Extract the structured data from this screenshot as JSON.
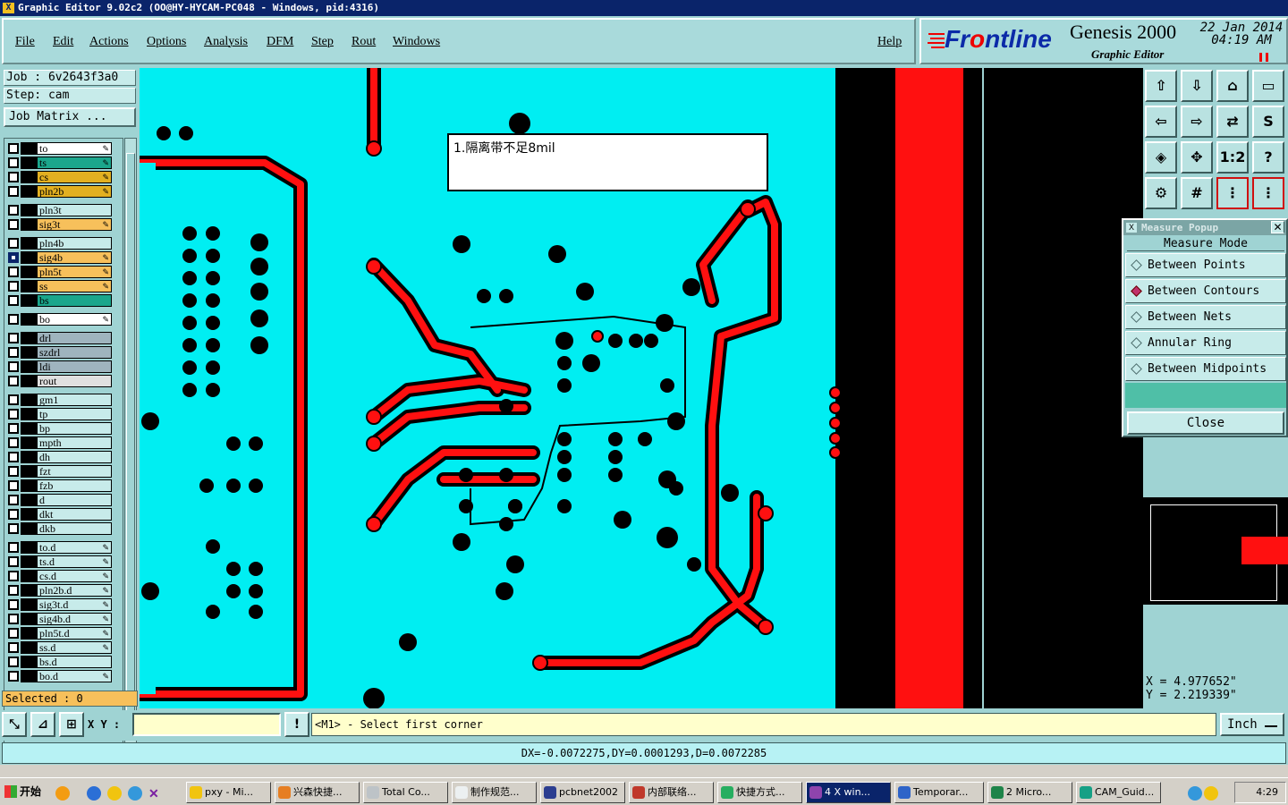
{
  "window": {
    "title": "Graphic Editor 9.02c2  (OO@HY-HYCAM-PC048 - Windows, pid:4316)"
  },
  "menu": [
    {
      "label": "File"
    },
    {
      "label": "Edit"
    },
    {
      "label": "Actions"
    },
    {
      "label": "Options"
    },
    {
      "label": "Analysis"
    },
    {
      "label": "DFM"
    },
    {
      "label": "Step"
    },
    {
      "label": "Rout"
    },
    {
      "label": "Windows"
    },
    {
      "label": "Help"
    }
  ],
  "brand": {
    "logo_prefix": "Fr",
    "logo_mid": "o",
    "logo_suffix": "ntline",
    "product": "Genesis 2000",
    "subtitle": "Graphic Editor",
    "date_line1": "22 Jan 2014",
    "date_line2": "04:19 AM"
  },
  "job": {
    "job_line": "Job : 6v2643f3a0",
    "step_line": "Step: cam",
    "matrix_button": "Job Matrix ..."
  },
  "layers": [
    {
      "name": "to",
      "color": "#ffffff",
      "side": "#000000",
      "pen": true
    },
    {
      "name": "ts",
      "color": "#1ba68c",
      "side": "#000000",
      "pen": true
    },
    {
      "name": "cs",
      "color": "#e2b021",
      "side": "#000000",
      "pen": true
    },
    {
      "name": "pln2b",
      "color": "#e2b021",
      "side": "#000000",
      "pen": true
    },
    {
      "name": "pln3t",
      "color": "#c7ebea",
      "side": "#000000",
      "pen": false
    },
    {
      "name": "sig3t",
      "color": "#f7c05b",
      "side": "#000000",
      "pen": true
    },
    {
      "name": "pln4b",
      "color": "#c7ebea",
      "side": "#000000",
      "pen": false
    },
    {
      "name": "sig4b",
      "color": "#f7c05b",
      "side": "#000000",
      "pen": true,
      "active": true
    },
    {
      "name": "pln5t",
      "color": "#f7c05b",
      "side": "#000000",
      "pen": true
    },
    {
      "name": "ss",
      "color": "#f7c05b",
      "side": "#000000",
      "pen": true
    },
    {
      "name": "bs",
      "color": "#1ba68c",
      "side": "#000000",
      "pen": false
    },
    {
      "name": "bo",
      "color": "#ffffff",
      "side": "#000000",
      "pen": true
    },
    {
      "name": "drl",
      "color": "#9fb4be",
      "side": "#000000",
      "pen": false
    },
    {
      "name": "szdrl",
      "color": "#9fb4be",
      "side": "#000000",
      "pen": false
    },
    {
      "name": "ldi",
      "color": "#9fb4be",
      "side": "#000000",
      "pen": false
    },
    {
      "name": "rout",
      "color": "#e0e0e0",
      "side": "#000000",
      "pen": false
    },
    {
      "name": "gm1",
      "color": "#c7ebea",
      "side": "#000000",
      "pen": false
    },
    {
      "name": "tp",
      "color": "#c7ebea",
      "side": "#000000",
      "pen": false
    },
    {
      "name": "bp",
      "color": "#c7ebea",
      "side": "#000000",
      "pen": false
    },
    {
      "name": "mpth",
      "color": "#c7ebea",
      "side": "#000000",
      "pen": false
    },
    {
      "name": "dh",
      "color": "#c7ebea",
      "side": "#000000",
      "pen": false
    },
    {
      "name": "fzt",
      "color": "#c7ebea",
      "side": "#000000",
      "pen": false
    },
    {
      "name": "fzb",
      "color": "#c7ebea",
      "side": "#000000",
      "pen": false
    },
    {
      "name": "d",
      "color": "#c7ebea",
      "side": "#000000",
      "pen": false
    },
    {
      "name": "dkt",
      "color": "#c7ebea",
      "side": "#000000",
      "pen": false
    },
    {
      "name": "dkb",
      "color": "#c7ebea",
      "side": "#000000",
      "pen": false
    },
    {
      "name": "to.d",
      "color": "#c7ebea",
      "side": "#000000",
      "pen": true
    },
    {
      "name": "ts.d",
      "color": "#c7ebea",
      "side": "#000000",
      "pen": true
    },
    {
      "name": "cs.d",
      "color": "#c7ebea",
      "side": "#000000",
      "pen": true
    },
    {
      "name": "pln2b.d",
      "color": "#c7ebea",
      "side": "#000000",
      "pen": true
    },
    {
      "name": "sig3t.d",
      "color": "#c7ebea",
      "side": "#000000",
      "pen": true
    },
    {
      "name": "sig4b.d",
      "color": "#c7ebea",
      "side": "#000000",
      "pen": true
    },
    {
      "name": "pln5t.d",
      "color": "#c7ebea",
      "side": "#000000",
      "pen": true
    },
    {
      "name": "ss.d",
      "color": "#c7ebea",
      "side": "#000000",
      "pen": true
    },
    {
      "name": "bs.d",
      "color": "#c7ebea",
      "side": "#000000",
      "pen": false
    },
    {
      "name": "bo.d",
      "color": "#c7ebea",
      "side": "#000000",
      "pen": true
    }
  ],
  "selected": "Selected : 0",
  "canvas": {
    "annotation": "1.隔离带不足8mil",
    "board_color": "#00eef2",
    "trace_color": "#ff1010"
  },
  "measure": {
    "title": "Measure Popup",
    "mode_label": "Measure Mode",
    "options": [
      {
        "label": "Between Points",
        "selected": false
      },
      {
        "label": "Between Contours",
        "selected": true
      },
      {
        "label": "Between Nets",
        "selected": false
      },
      {
        "label": "Annular Ring",
        "selected": false
      },
      {
        "label": "Between Midpoints",
        "selected": false
      }
    ],
    "close_label": "Close"
  },
  "coords": {
    "x": "X = 4.977652\"",
    "y": "Y = 2.219339\""
  },
  "bottom": {
    "xy_label": "X Y :",
    "xy_value": "",
    "prompt": "<M1> - Select first corner",
    "unit": "Inch"
  },
  "status": "DX=-0.0072275,DY=0.0001293,D=0.0072285",
  "taskbar": {
    "start": "开始",
    "items": [
      {
        "label": "pxy - Mi...",
        "icon": "clock-icon"
      },
      {
        "label": "兴森快捷...",
        "icon": "star-icon"
      },
      {
        "label": "Total Co...",
        "icon": "folder-icon"
      },
      {
        "label": "制作规范...",
        "icon": "document-icon"
      },
      {
        "label": "pcbnet2002",
        "icon": "shield-icon"
      },
      {
        "label": "内部联络...",
        "icon": "pdf-icon"
      },
      {
        "label": "快捷方式...",
        "icon": "shortcut-icon"
      },
      {
        "label": "4 X win...",
        "icon": "x-icon"
      },
      {
        "label": "Temporar...",
        "icon": "word-icon"
      },
      {
        "label": "2 Micro...",
        "icon": "excel-icon"
      },
      {
        "label": "CAM_Guid...",
        "icon": "car-icon"
      }
    ],
    "clock": "4:29"
  }
}
